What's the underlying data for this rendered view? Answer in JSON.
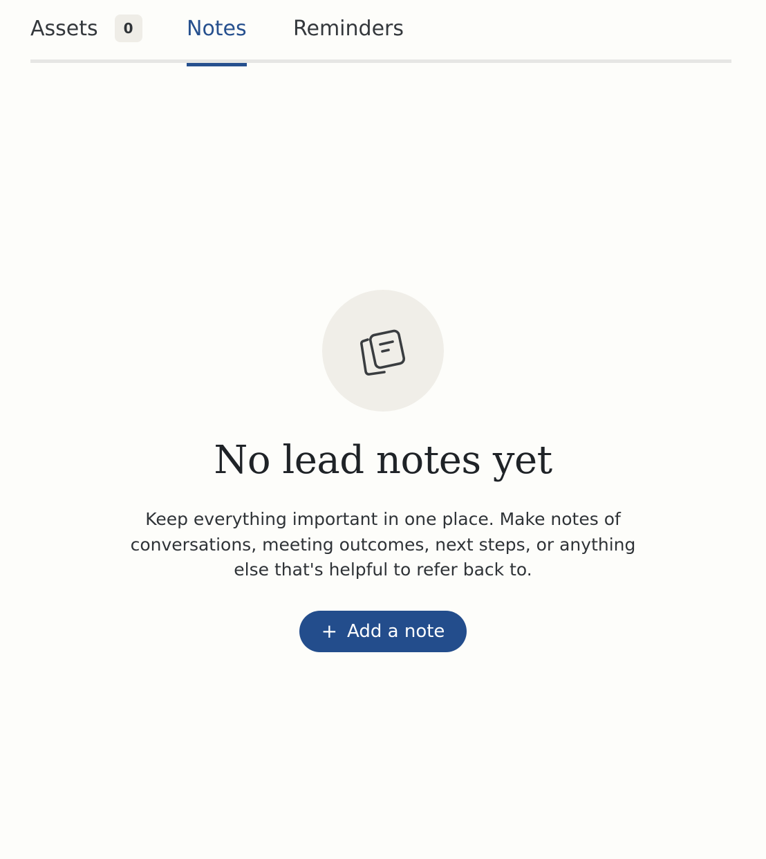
{
  "tabs": {
    "assets": {
      "label": "Assets",
      "count": "0"
    },
    "notes": {
      "label": "Notes",
      "active": true
    },
    "reminders": {
      "label": "Reminders"
    }
  },
  "empty_state": {
    "icon": "notes-stack-icon",
    "title": "No lead notes yet",
    "description": "Keep everything important in one place. Make notes of conversations, meeting outcomes, next steps, or anything else that's helpful to refer back to.",
    "button_label": "Add a note",
    "button_icon": "plus-icon"
  },
  "colors": {
    "accent": "#234d8c",
    "icon_circle": "#f0eee8",
    "background": "#fdfdfa"
  }
}
